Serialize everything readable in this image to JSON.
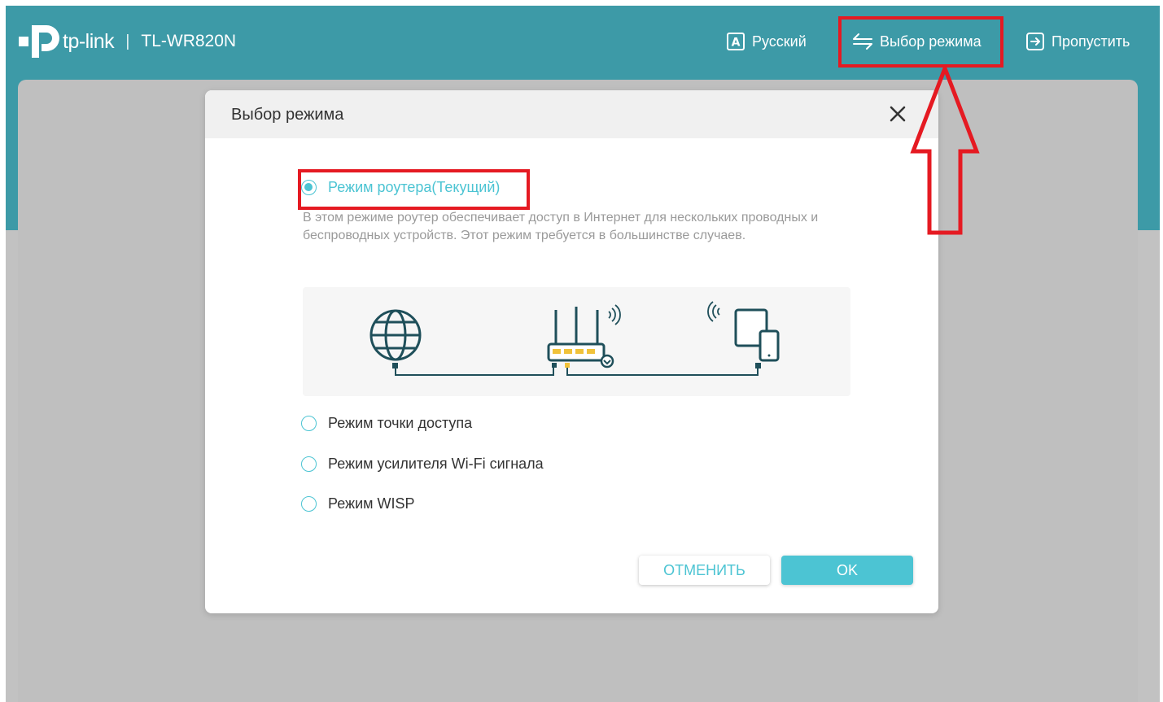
{
  "header": {
    "brand": "tp-link",
    "separator": "|",
    "model": "TL-WR820N",
    "nav": {
      "language_label": "Русский",
      "mode_label": "Выбор режима",
      "skip_label": "Пропустить"
    }
  },
  "modal": {
    "title": "Выбор режима",
    "options": [
      {
        "label": "Режим роутера(Текущий)",
        "selected": true
      },
      {
        "label": "Режим точки доступа",
        "selected": false
      },
      {
        "label": "Режим усилителя Wi-Fi сигнала",
        "selected": false
      },
      {
        "label": "Режим WISP",
        "selected": false
      }
    ],
    "description": "В этом режиме роутер обеспечивает доступ в Интернет для нескольких проводных и беспроводных устройств. Этот режим требуется в большинстве случаев.",
    "diagram_icons": [
      "globe-icon",
      "router-icon",
      "devices-icon"
    ],
    "cancel_label": "ОТМЕНИТЬ",
    "ok_label": "OK"
  },
  "colors": {
    "accent": "#4cc4d3",
    "header_bg": "#3d9aa7",
    "highlight": "#e51a22",
    "overlay_bg": "#c2c2c2"
  }
}
